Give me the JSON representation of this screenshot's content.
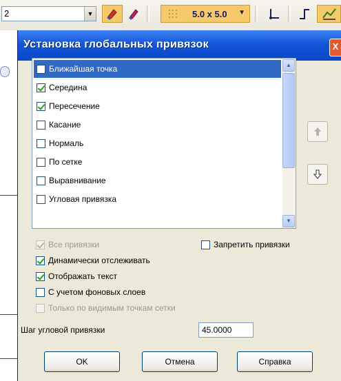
{
  "toolbar": {
    "combo_left_value": "2",
    "grid_value": "5.0 x 5.0"
  },
  "dialog": {
    "title": "Установка глобальных привязок",
    "close_label": "X"
  },
  "snap_list": {
    "items": [
      {
        "label": "Ближайшая точка",
        "checked": false,
        "selected": true
      },
      {
        "label": "Середина",
        "checked": true,
        "selected": false
      },
      {
        "label": "Пересечение",
        "checked": true,
        "selected": false
      },
      {
        "label": "Касание",
        "checked": false,
        "selected": false
      },
      {
        "label": "Нормаль",
        "checked": false,
        "selected": false
      },
      {
        "label": "По сетке",
        "checked": false,
        "selected": false
      },
      {
        "label": "Выравнивание",
        "checked": false,
        "selected": false
      },
      {
        "label": "Угловая привязка",
        "checked": false,
        "selected": false
      }
    ]
  },
  "options": {
    "all_snaps": {
      "label": "Все привязки",
      "checked": true,
      "enabled": false
    },
    "forbid_snaps": {
      "label": "Запретить привязки",
      "checked": false,
      "enabled": true
    },
    "dynamic_tracking": {
      "label": "Динамически отслеживать",
      "checked": true,
      "enabled": true
    },
    "show_text": {
      "label": "Отображать текст",
      "checked": true,
      "enabled": true
    },
    "background_layers": {
      "label": "С учетом фоновых слоев",
      "checked": false,
      "enabled": true
    },
    "visible_grid_only": {
      "label": "Только по видимым точкам сетки",
      "checked": false,
      "enabled": false
    }
  },
  "angle_step": {
    "label": "Шаг угловой привязки",
    "value": "45.0000"
  },
  "buttons": {
    "ok": "OK",
    "cancel": "Отмена",
    "help": "Справка"
  },
  "colors": {
    "title_bar": "#0a47c8",
    "selection": "#316ac5",
    "dialog_bg": "#ece9d8",
    "toolbar_active": "#f6c96b"
  }
}
